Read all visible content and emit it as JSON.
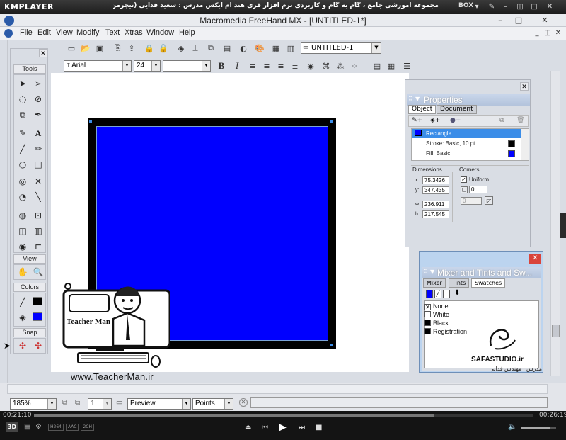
{
  "player": {
    "name": "KMPLAYER",
    "title": "مجموعه آموزشی جامع ، گام به گام و کاربردی نرم افزار فری هند ام ایکس   مدرس : سعید فدایی (تیچرمن ) گروه آموزشی پادشاه گرافیست ها",
    "box_label": "BOX",
    "time_elapsed": "00:21:10",
    "time_total": "00:26:19",
    "progress_fraction": 0.8
  },
  "app": {
    "title": "Macromedia FreeHand MX - [UNTITLED-1*]",
    "menus": [
      "File",
      "Edit",
      "View",
      "Modify",
      "Text",
      "Xtras",
      "Window",
      "Help"
    ],
    "document_select": "UNTITLED-1",
    "font_select": "Arial",
    "size_select": "24",
    "bold_label": "B",
    "italic_label": "I"
  },
  "toolbox": {
    "sections": [
      "Tools",
      "View",
      "Colors",
      "Snap"
    ]
  },
  "properties": {
    "title": "Properties",
    "tabs": [
      "Object",
      "Document"
    ],
    "tree": [
      "Rectangle",
      "Stroke: Basic, 10 pt",
      "Fill: Basic"
    ],
    "dimensions_label": "Dimensions",
    "corners_label": "Corners",
    "x_label": "x:",
    "x_value": "75.3426",
    "y_label": "y:",
    "y_value": "347.435",
    "w_label": "w:",
    "w_value": "236.911",
    "h_label": "h:",
    "h_value": "217.545",
    "uniform_label": "Uniform",
    "corner_value": "0",
    "corner_value2": "0"
  },
  "mixer": {
    "title": "Mixer and Tints and Sw...",
    "tabs": [
      "Mixer",
      "Tints",
      "Swatches"
    ],
    "swatches": [
      {
        "name": "None",
        "color": "none"
      },
      {
        "name": "White",
        "color": "#ffffff"
      },
      {
        "name": "Black",
        "color": "#000000"
      },
      {
        "name": "Registration",
        "color": "#000000"
      }
    ]
  },
  "status": {
    "zoom": "185%",
    "page": "1",
    "view_mode": "Preview",
    "units": "Points"
  },
  "watermarks": {
    "teacherman_url": "www.TeacherMan.ir",
    "teacherman_name": "Teacher Man",
    "safa": "SAFASTUDIO.ir",
    "safa_sub": "مدرس : مهندس فدایی"
  },
  "colors": {
    "rect_fill": "#0000ff",
    "rect_stroke": "#000000",
    "selection": "#3b8de8"
  }
}
